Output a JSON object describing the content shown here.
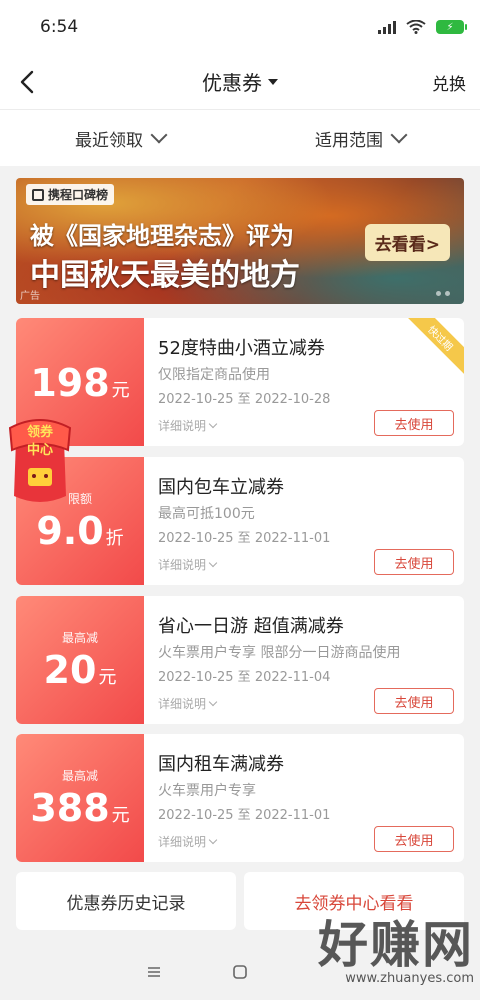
{
  "status": {
    "time": "6:54",
    "battery_icon": "battery-charging-icon"
  },
  "nav": {
    "title": "优惠券",
    "action": "兑换"
  },
  "filters": [
    {
      "label": "最近领取"
    },
    {
      "label": "适用范围"
    }
  ],
  "banner": {
    "brand": "携程口碑榜",
    "line1": "被《国家地理杂志》评为",
    "line2": "中国秋天最美的地方",
    "cta": "去看看>",
    "ad_label": "广告"
  },
  "float_badge": {
    "text_top": "领券",
    "text_bottom": "中心"
  },
  "coupons": [
    {
      "small": "",
      "amount": "198",
      "unit": "元",
      "title": "52度特曲小酒立减券",
      "desc": "仅限指定商品使用",
      "date": "2022-10-25 至 2022-10-28",
      "detail": "详细说明",
      "use": "去使用",
      "tag": "快过期"
    },
    {
      "small": "限额",
      "amount": "9.0",
      "unit": "折",
      "title": "国内包车立减券",
      "desc": "最高可抵100元",
      "date": "2022-10-25 至 2022-11-01",
      "detail": "详细说明",
      "use": "去使用"
    },
    {
      "small": "最高减",
      "amount": "20",
      "unit": "元",
      "title": "省心一日游 超值满减券",
      "desc": "火车票用户专享 限部分一日游商品使用",
      "date": "2022-10-25 至 2022-11-04",
      "detail": "详细说明",
      "use": "去使用"
    },
    {
      "small": "最高减",
      "amount": "388",
      "unit": "元",
      "title": "国内租车满减券",
      "desc": "火车票用户专享",
      "date": "2022-10-25 至 2022-11-01",
      "detail": "详细说明",
      "use": "去使用"
    }
  ],
  "bottom": {
    "history": "优惠券历史记录",
    "center": "去领券中心看看"
  },
  "watermark": {
    "main": "好赚网",
    "sub": "www.zhuanyes.com"
  },
  "colors": {
    "coupon_gradient_start": "#ff8a78",
    "coupon_gradient_end": "#f24a4a",
    "accent_red": "#d8473a",
    "tag_yellow": "#f5c84a"
  }
}
